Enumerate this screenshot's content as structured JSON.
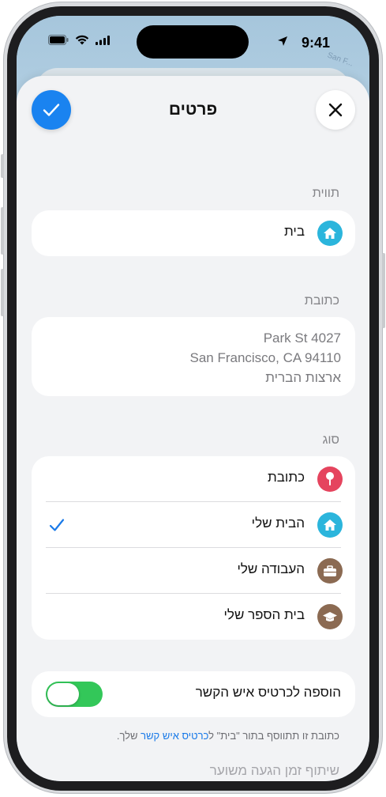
{
  "status_bar": {
    "time": "9:41"
  },
  "map": {
    "road_label": "San F..."
  },
  "header": {
    "title": "פרטים"
  },
  "labels_section": {
    "label": "תווית",
    "value": "בית"
  },
  "address_section": {
    "label": "כתובת",
    "line1": "Park St 4027",
    "line2": "San Francisco, CA 94110",
    "line3": "ארצות הברית"
  },
  "type_section": {
    "label": "סוג",
    "items": [
      {
        "label": "כתובת",
        "icon": "pin-icon",
        "selected": false
      },
      {
        "label": "הבית שלי",
        "icon": "house-icon",
        "selected": true
      },
      {
        "label": "העבודה שלי",
        "icon": "briefcase-icon",
        "selected": false
      },
      {
        "label": "בית הספר שלי",
        "icon": "graduation-cap-icon",
        "selected": false
      }
    ]
  },
  "contact_section": {
    "label": "הוספה לכרטיס איש הקשר",
    "enabled": true,
    "footnote_before": "כתובת זו תתווסף בתור \"בית\" ל",
    "footnote_link": "כרטיס איש קשר",
    "footnote_after": " שלך."
  },
  "eta_section": {
    "label": "שיתוף זמן הגעה משוער"
  },
  "colors": {
    "accent": "#1a83f0",
    "toggle_on": "#33c759",
    "house_icon": "#2bb5dc",
    "pin_icon": "#e5445e",
    "work_icon": "#8b6a52"
  }
}
